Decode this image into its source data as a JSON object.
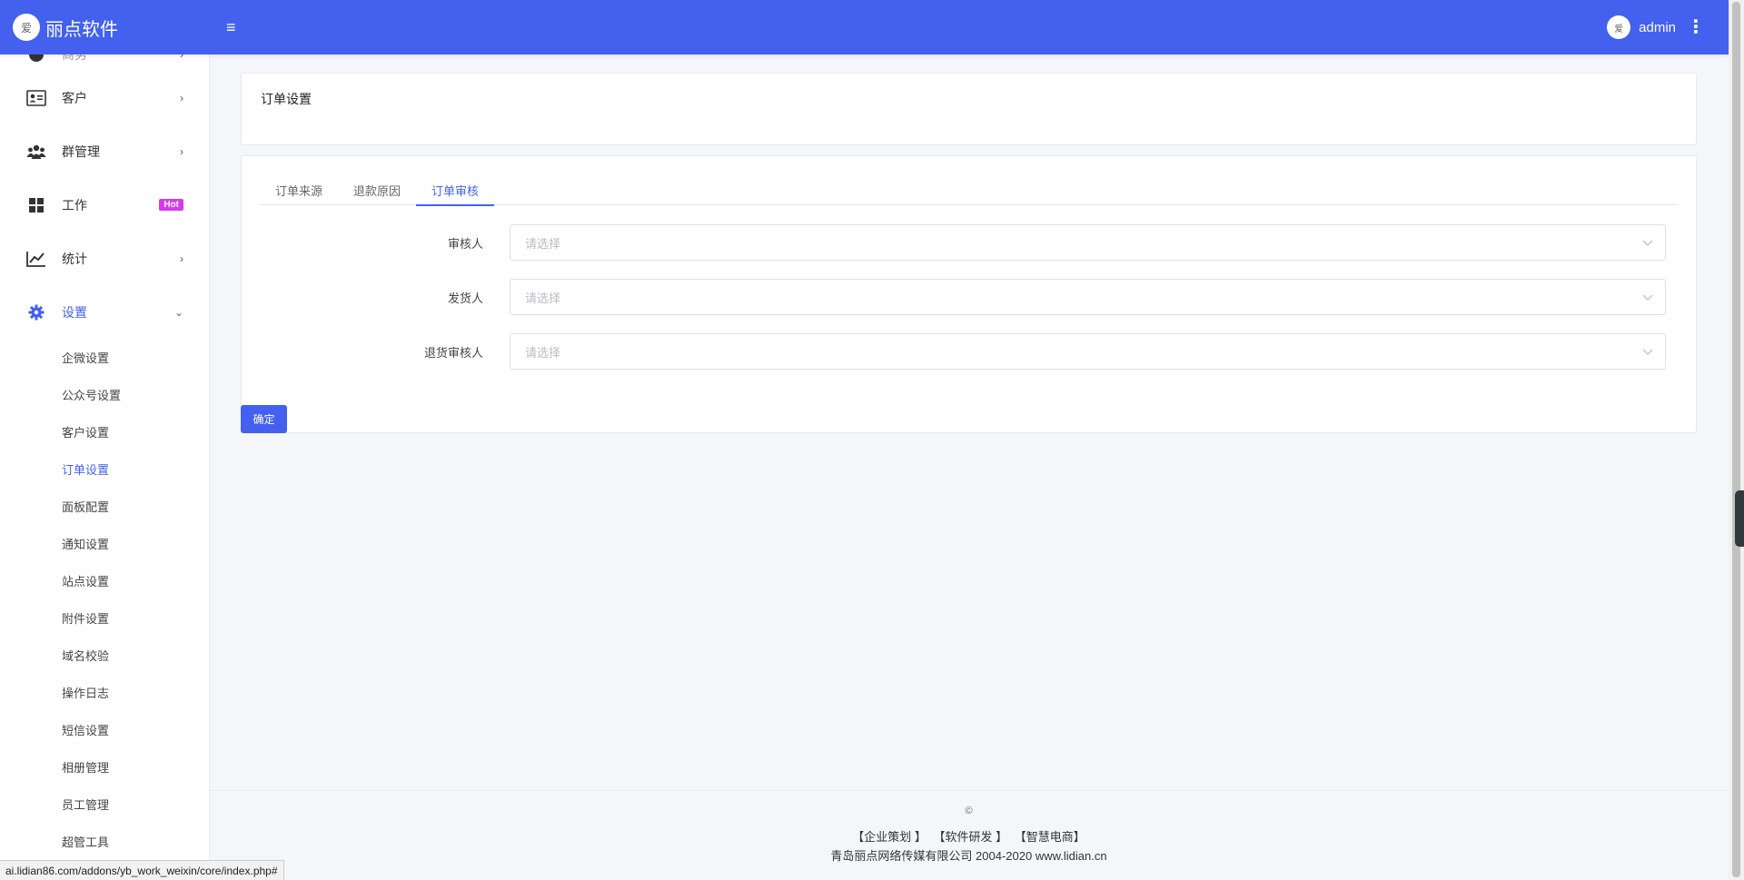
{
  "header": {
    "brand_logo": "爱",
    "brand_name": "丽点软件",
    "menu_icon": "≡",
    "user_avatar": "爱",
    "user_name": "admin",
    "more_icon": "⋮"
  },
  "sidebar": {
    "partial_label": "商务",
    "items": [
      {
        "label": "客户"
      },
      {
        "label": "群管理"
      },
      {
        "label": "工作",
        "badge": "Hot"
      },
      {
        "label": "统计"
      },
      {
        "label": "设置"
      }
    ],
    "sub_items": [
      "企微设置",
      "公众号设置",
      "客户设置",
      "订单设置",
      "面板配置",
      "通知设置",
      "站点设置",
      "附件设置",
      "域名校验",
      "操作日志",
      "短信设置",
      "相册管理",
      "员工管理",
      "超管工具"
    ]
  },
  "page": {
    "title": "订单设置",
    "tabs": [
      "订单来源",
      "退款原因",
      "订单审核"
    ],
    "fields": [
      {
        "label": "审核人",
        "placeholder": "请选择"
      },
      {
        "label": "发货人",
        "placeholder": "请选择"
      },
      {
        "label": "退货审核人",
        "placeholder": "请选择"
      }
    ],
    "confirm_label": "确定"
  },
  "footer": {
    "copyright": "©",
    "links": [
      "【企业策划 】",
      "【软件研发 】",
      "【智慧电商】"
    ],
    "company": "青岛丽点网络传媒有限公司 2004-2020 www.lidian.cn"
  },
  "status_bar": "ai.lidian86.com/addons/yb_work_weixin/core/index.php#",
  "colors": {
    "accent": "#4361ee",
    "hot_badge": "#d63aeb"
  }
}
